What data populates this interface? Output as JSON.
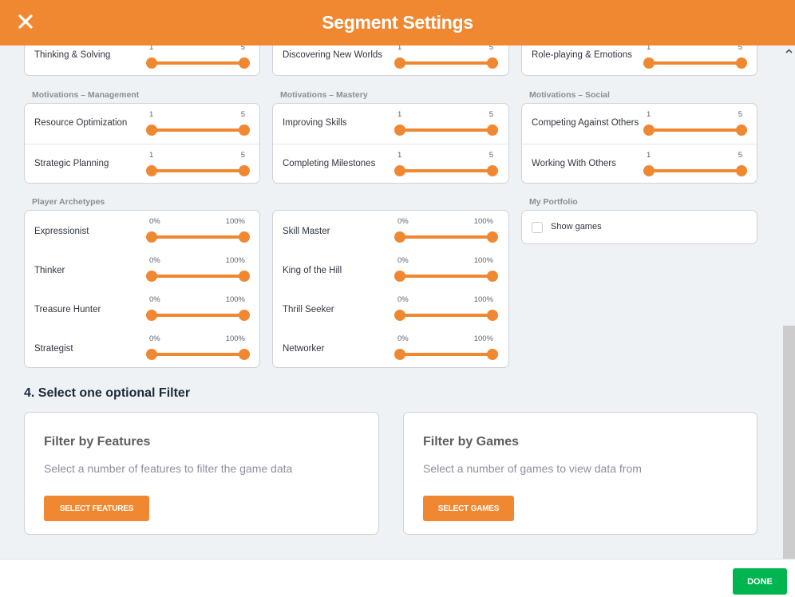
{
  "header": {
    "title": "Segment Settings",
    "close_icon": "close-icon"
  },
  "top_row": [
    {
      "label": "Thinking & Solving",
      "min": "1",
      "max": "5",
      "value_low": 1,
      "value_high": 5
    },
    {
      "label": "Discovering New Worlds",
      "min": "1",
      "max": "5",
      "value_low": 1,
      "value_high": 5
    },
    {
      "label": "Role-playing & Emotions",
      "min": "1",
      "max": "5",
      "value_low": 1,
      "value_high": 5
    }
  ],
  "groups": {
    "management": {
      "title": "Motivations – Management",
      "rows": [
        {
          "label": "Resource Optimization",
          "min": "1",
          "max": "5",
          "value_low": 1,
          "value_high": 5
        },
        {
          "label": "Strategic Planning",
          "min": "1",
          "max": "5",
          "value_low": 1,
          "value_high": 5
        }
      ]
    },
    "mastery": {
      "title": "Motivations – Mastery",
      "rows": [
        {
          "label": "Improving Skills",
          "min": "1",
          "max": "5",
          "value_low": 1,
          "value_high": 5
        },
        {
          "label": "Completing Milestones",
          "min": "1",
          "max": "5",
          "value_low": 1,
          "value_high": 5
        }
      ]
    },
    "social": {
      "title": "Motivations – Social",
      "rows": [
        {
          "label": "Competing Against Others",
          "min": "1",
          "max": "5",
          "value_low": 1,
          "value_high": 5
        },
        {
          "label": "Working With Others",
          "min": "1",
          "max": "5",
          "value_low": 1,
          "value_high": 5
        }
      ]
    },
    "archetypes": {
      "title": "Player Archetypes",
      "left": [
        {
          "label": "Expressionist",
          "min": "0%",
          "max": "100%",
          "value_low": 0,
          "value_high": 100
        },
        {
          "label": "Thinker",
          "min": "0%",
          "max": "100%",
          "value_low": 0,
          "value_high": 100
        },
        {
          "label": "Treasure Hunter",
          "min": "0%",
          "max": "100%",
          "value_low": 0,
          "value_high": 100
        },
        {
          "label": "Strategist",
          "min": "0%",
          "max": "100%",
          "value_low": 0,
          "value_high": 100
        }
      ],
      "right": [
        {
          "label": "Skill Master",
          "min": "0%",
          "max": "100%",
          "value_low": 0,
          "value_high": 100
        },
        {
          "label": "King of the Hill",
          "min": "0%",
          "max": "100%",
          "value_low": 0,
          "value_high": 100
        },
        {
          "label": "Thrill Seeker",
          "min": "0%",
          "max": "100%",
          "value_low": 0,
          "value_high": 100
        },
        {
          "label": "Networker",
          "min": "0%",
          "max": "100%",
          "value_low": 0,
          "value_high": 100
        }
      ]
    },
    "portfolio": {
      "title": "My Portfolio",
      "checkbox_label": "Show games",
      "checked": false
    }
  },
  "filter_section": {
    "heading": "4. Select one optional Filter",
    "features": {
      "title": "Filter by Features",
      "description": "Select a number of features to filter the game data",
      "button": "SELECT FEATURES"
    },
    "games": {
      "title": "Filter by Games",
      "description": "Select a number of games to view data from",
      "button": "SELECT GAMES"
    }
  },
  "footer": {
    "done_label": "DONE"
  },
  "colors": {
    "accent": "#f08832",
    "done": "#00b54f",
    "background": "#eef2f5"
  }
}
